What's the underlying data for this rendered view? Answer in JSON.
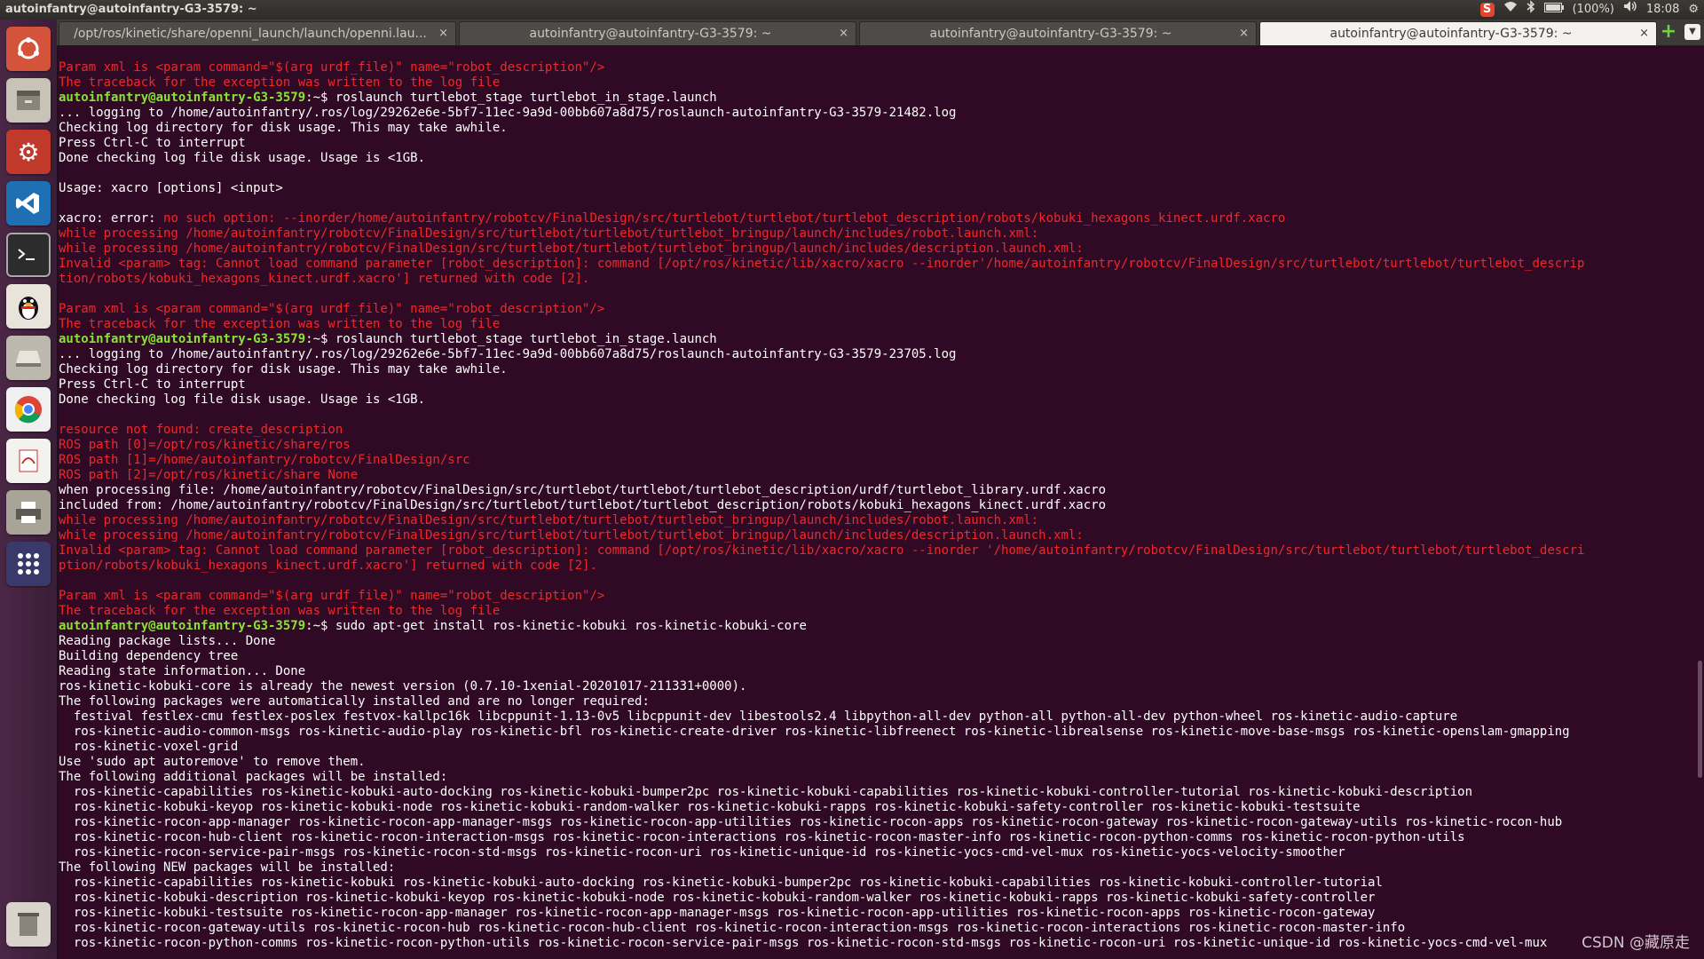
{
  "window_title": "autoinfantry@autoinfantry-G3-3579: ~",
  "tray": {
    "battery": "(100%)",
    "time": "18:08"
  },
  "tabs": [
    {
      "label": "/opt/ros/kinetic/share/openni_launch/launch/openni.lau...",
      "close": "×"
    },
    {
      "label": "autoinfantry@autoinfantry-G3-3579: ~",
      "close": "×"
    },
    {
      "label": "autoinfantry@autoinfantry-G3-3579: ~",
      "close": "×"
    },
    {
      "label": "autoinfantry@autoinfantry-G3-3579: ~",
      "close": "×"
    }
  ],
  "watermark": "CSDN @藏原走",
  "terminal_lines": [
    {
      "segs": [
        {
          "t": "Param xml is <param command=\"$(arg urdf_file)\" name=\"robot_description\"/>",
          "c": "r"
        }
      ]
    },
    {
      "segs": [
        {
          "t": "The traceback for the exception was written to the log file",
          "c": "r"
        }
      ]
    },
    {
      "segs": [
        {
          "t": "autoinfantry@autoinfantry-G3-3579",
          "c": "p"
        },
        {
          "t": ":~$ roslaunch turtlebot_stage turtlebot_in_stage.launch",
          "c": "w"
        }
      ]
    },
    {
      "segs": [
        {
          "t": "... logging to /home/autoinfantry/.ros/log/29262e6e-5bf7-11ec-9a9d-00bb607a8d75/roslaunch-autoinfantry-G3-3579-21482.log",
          "c": "w"
        }
      ]
    },
    {
      "segs": [
        {
          "t": "Checking log directory for disk usage. This may take awhile.",
          "c": "w"
        }
      ]
    },
    {
      "segs": [
        {
          "t": "Press Ctrl-C to interrupt",
          "c": "w"
        }
      ]
    },
    {
      "segs": [
        {
          "t": "Done checking log file disk usage. Usage is <1GB.",
          "c": "w"
        }
      ]
    },
    {
      "segs": [
        {
          "t": "",
          "c": "w"
        }
      ]
    },
    {
      "segs": [
        {
          "t": "Usage: xacro [options] <input>",
          "c": "w"
        }
      ]
    },
    {
      "segs": [
        {
          "t": "",
          "c": "w"
        }
      ]
    },
    {
      "segs": [
        {
          "t": "xacro: error: ",
          "c": "w"
        },
        {
          "t": "no such option: --inorder/home/autoinfantry/robotcv/FinalDesign/src/turtlebot/turtlebot/turtlebot_description/robots/kobuki_hexagons_kinect.urdf.xacro",
          "c": "r"
        }
      ]
    },
    {
      "segs": [
        {
          "t": "while processing /home/autoinfantry/robotcv/FinalDesign/src/turtlebot/turtlebot/turtlebot_bringup/launch/includes/robot.launch.xml:",
          "c": "r"
        }
      ]
    },
    {
      "segs": [
        {
          "t": "while processing /home/autoinfantry/robotcv/FinalDesign/src/turtlebot/turtlebot/turtlebot_bringup/launch/includes/description.launch.xml:",
          "c": "r"
        }
      ]
    },
    {
      "segs": [
        {
          "t": "Invalid <param> tag: Cannot load command parameter [robot_description]: command [/opt/ros/kinetic/lib/xacro/xacro --inorder'/home/autoinfantry/robotcv/FinalDesign/src/turtlebot/turtlebot/turtlebot_descrip",
          "c": "r"
        }
      ]
    },
    {
      "segs": [
        {
          "t": "tion/robots/kobuki_hexagons_kinect.urdf.xacro'] returned with code [2].",
          "c": "r"
        }
      ]
    },
    {
      "segs": [
        {
          "t": "",
          "c": "w"
        }
      ]
    },
    {
      "segs": [
        {
          "t": "Param xml is <param command=\"$(arg urdf_file)\" name=\"robot_description\"/>",
          "c": "r"
        }
      ]
    },
    {
      "segs": [
        {
          "t": "The traceback for the exception was written to the log file",
          "c": "r"
        }
      ]
    },
    {
      "segs": [
        {
          "t": "autoinfantry@autoinfantry-G3-3579",
          "c": "p"
        },
        {
          "t": ":~$ roslaunch turtlebot_stage turtlebot_in_stage.launch",
          "c": "w"
        }
      ]
    },
    {
      "segs": [
        {
          "t": "... logging to /home/autoinfantry/.ros/log/29262e6e-5bf7-11ec-9a9d-00bb607a8d75/roslaunch-autoinfantry-G3-3579-23705.log",
          "c": "w"
        }
      ]
    },
    {
      "segs": [
        {
          "t": "Checking log directory for disk usage. This may take awhile.",
          "c": "w"
        }
      ]
    },
    {
      "segs": [
        {
          "t": "Press Ctrl-C to interrupt",
          "c": "w"
        }
      ]
    },
    {
      "segs": [
        {
          "t": "Done checking log file disk usage. Usage is <1GB.",
          "c": "w"
        }
      ]
    },
    {
      "segs": [
        {
          "t": "",
          "c": "w"
        }
      ]
    },
    {
      "segs": [
        {
          "t": "resource not found: create_description",
          "c": "r"
        }
      ]
    },
    {
      "segs": [
        {
          "t": "ROS path [0]=/opt/ros/kinetic/share/ros",
          "c": "r"
        }
      ]
    },
    {
      "segs": [
        {
          "t": "ROS path [1]=/home/autoinfantry/robotcv/FinalDesign/src",
          "c": "r"
        }
      ]
    },
    {
      "segs": [
        {
          "t": "ROS path [2]=/opt/ros/kinetic/share None",
          "c": "r"
        }
      ]
    },
    {
      "segs": [
        {
          "t": "when processing file: /home/autoinfantry/robotcv/FinalDesign/src/turtlebot/turtlebot/turtlebot_description/urdf/turtlebot_library.urdf.xacro",
          "c": "w"
        }
      ]
    },
    {
      "segs": [
        {
          "t": "included from: /home/autoinfantry/robotcv/FinalDesign/src/turtlebot/turtlebot/turtlebot_description/robots/kobuki_hexagons_kinect.urdf.xacro",
          "c": "w"
        }
      ]
    },
    {
      "segs": [
        {
          "t": "while processing /home/autoinfantry/robotcv/FinalDesign/src/turtlebot/turtlebot/turtlebot_bringup/launch/includes/robot.launch.xml:",
          "c": "r"
        }
      ]
    },
    {
      "segs": [
        {
          "t": "while processing /home/autoinfantry/robotcv/FinalDesign/src/turtlebot/turtlebot/turtlebot_bringup/launch/includes/description.launch.xml:",
          "c": "r"
        }
      ]
    },
    {
      "segs": [
        {
          "t": "Invalid <param> tag: Cannot load command parameter [robot_description]: command [/opt/ros/kinetic/lib/xacro/xacro --inorder '/home/autoinfantry/robotcv/FinalDesign/src/turtlebot/turtlebot/turtlebot_descri",
          "c": "r"
        }
      ]
    },
    {
      "segs": [
        {
          "t": "ption/robots/kobuki_hexagons_kinect.urdf.xacro'] returned with code [2].",
          "c": "r"
        }
      ]
    },
    {
      "segs": [
        {
          "t": "",
          "c": "w"
        }
      ]
    },
    {
      "segs": [
        {
          "t": "Param xml is <param command=\"$(arg urdf_file)\" name=\"robot_description\"/>",
          "c": "r"
        }
      ]
    },
    {
      "segs": [
        {
          "t": "The traceback for the exception was written to the log file",
          "c": "r"
        }
      ]
    },
    {
      "segs": [
        {
          "t": "autoinfantry@autoinfantry-G3-3579",
          "c": "p"
        },
        {
          "t": ":~$ sudo apt-get install ros-kinetic-kobuki ros-kinetic-kobuki-core",
          "c": "w"
        }
      ]
    },
    {
      "segs": [
        {
          "t": "Reading package lists... Done",
          "c": "w"
        }
      ]
    },
    {
      "segs": [
        {
          "t": "Building dependency tree",
          "c": "w"
        }
      ]
    },
    {
      "segs": [
        {
          "t": "Reading state information... Done",
          "c": "w"
        }
      ]
    },
    {
      "segs": [
        {
          "t": "ros-kinetic-kobuki-core is already the newest version (0.7.10-1xenial-20201017-211331+0000).",
          "c": "w"
        }
      ]
    },
    {
      "segs": [
        {
          "t": "The following packages were automatically installed and are no longer required:",
          "c": "w"
        }
      ]
    },
    {
      "segs": [
        {
          "t": "  festival festlex-cmu festlex-poslex festvox-kallpc16k libcppunit-1.13-0v5 libcppunit-dev libestools2.4 libpython-all-dev python-all python-all-dev python-wheel ros-kinetic-audio-capture",
          "c": "w"
        }
      ]
    },
    {
      "segs": [
        {
          "t": "  ros-kinetic-audio-common-msgs ros-kinetic-audio-play ros-kinetic-bfl ros-kinetic-create-driver ros-kinetic-libfreenect ros-kinetic-librealsense ros-kinetic-move-base-msgs ros-kinetic-openslam-gmapping",
          "c": "w"
        }
      ]
    },
    {
      "segs": [
        {
          "t": "  ros-kinetic-voxel-grid",
          "c": "w"
        }
      ]
    },
    {
      "segs": [
        {
          "t": "Use 'sudo apt autoremove' to remove them.",
          "c": "w"
        }
      ]
    },
    {
      "segs": [
        {
          "t": "The following additional packages will be installed:",
          "c": "w"
        }
      ]
    },
    {
      "segs": [
        {
          "t": "  ros-kinetic-capabilities ros-kinetic-kobuki-auto-docking ros-kinetic-kobuki-bumper2pc ros-kinetic-kobuki-capabilities ros-kinetic-kobuki-controller-tutorial ros-kinetic-kobuki-description",
          "c": "w"
        }
      ]
    },
    {
      "segs": [
        {
          "t": "  ros-kinetic-kobuki-keyop ros-kinetic-kobuki-node ros-kinetic-kobuki-random-walker ros-kinetic-kobuki-rapps ros-kinetic-kobuki-safety-controller ros-kinetic-kobuki-testsuite",
          "c": "w"
        }
      ]
    },
    {
      "segs": [
        {
          "t": "  ros-kinetic-rocon-app-manager ros-kinetic-rocon-app-manager-msgs ros-kinetic-rocon-app-utilities ros-kinetic-rocon-apps ros-kinetic-rocon-gateway ros-kinetic-rocon-gateway-utils ros-kinetic-rocon-hub",
          "c": "w"
        }
      ]
    },
    {
      "segs": [
        {
          "t": "  ros-kinetic-rocon-hub-client ros-kinetic-rocon-interaction-msgs ros-kinetic-rocon-interactions ros-kinetic-rocon-master-info ros-kinetic-rocon-python-comms ros-kinetic-rocon-python-utils",
          "c": "w"
        }
      ]
    },
    {
      "segs": [
        {
          "t": "  ros-kinetic-rocon-service-pair-msgs ros-kinetic-rocon-std-msgs ros-kinetic-rocon-uri ros-kinetic-unique-id ros-kinetic-yocs-cmd-vel-mux ros-kinetic-yocs-velocity-smoother",
          "c": "w"
        }
      ]
    },
    {
      "segs": [
        {
          "t": "The following NEW packages will be installed:",
          "c": "w"
        }
      ]
    },
    {
      "segs": [
        {
          "t": "  ros-kinetic-capabilities ros-kinetic-kobuki ros-kinetic-kobuki-auto-docking ros-kinetic-kobuki-bumper2pc ros-kinetic-kobuki-capabilities ros-kinetic-kobuki-controller-tutorial",
          "c": "w"
        }
      ]
    },
    {
      "segs": [
        {
          "t": "  ros-kinetic-kobuki-description ros-kinetic-kobuki-keyop ros-kinetic-kobuki-node ros-kinetic-kobuki-random-walker ros-kinetic-kobuki-rapps ros-kinetic-kobuki-safety-controller",
          "c": "w"
        }
      ]
    },
    {
      "segs": [
        {
          "t": "  ros-kinetic-kobuki-testsuite ros-kinetic-rocon-app-manager ros-kinetic-rocon-app-manager-msgs ros-kinetic-rocon-app-utilities ros-kinetic-rocon-apps ros-kinetic-rocon-gateway",
          "c": "w"
        }
      ]
    },
    {
      "segs": [
        {
          "t": "  ros-kinetic-rocon-gateway-utils ros-kinetic-rocon-hub ros-kinetic-rocon-hub-client ros-kinetic-rocon-interaction-msgs ros-kinetic-rocon-interactions ros-kinetic-rocon-master-info",
          "c": "w"
        }
      ]
    },
    {
      "segs": [
        {
          "t": "  ros-kinetic-rocon-python-comms ros-kinetic-rocon-python-utils ros-kinetic-rocon-service-pair-msgs ros-kinetic-rocon-std-msgs ros-kinetic-rocon-uri ros-kinetic-unique-id ros-kinetic-yocs-cmd-vel-mux",
          "c": "w"
        }
      ]
    }
  ]
}
